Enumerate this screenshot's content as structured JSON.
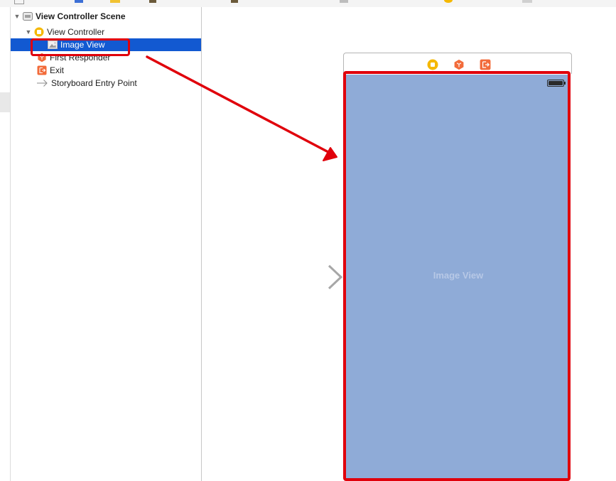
{
  "outline": {
    "items": [
      {
        "label": "View Controller Scene",
        "icon": "scene-icon",
        "expanded": true
      },
      {
        "label": "View Controller",
        "icon": "view-controller-icon",
        "expanded": true
      },
      {
        "label": "Image View",
        "icon": "image-view-icon",
        "selected": true
      },
      {
        "label": "First Responder",
        "icon": "first-responder-icon"
      },
      {
        "label": "Exit",
        "icon": "exit-icon"
      },
      {
        "label": "Storyboard Entry Point",
        "icon": "entry-arrow-icon"
      }
    ]
  },
  "canvas": {
    "image_view_label": "Image View",
    "scene_bar_icons": [
      "view-controller-icon",
      "first-responder-icon",
      "exit-icon"
    ]
  },
  "colors": {
    "highlight": "#e0000b",
    "selection": "#1259d1",
    "image_view_fill": "#8fabd7",
    "vc_yellow": "#f5b800",
    "exit_orange": "#f26b3a"
  }
}
